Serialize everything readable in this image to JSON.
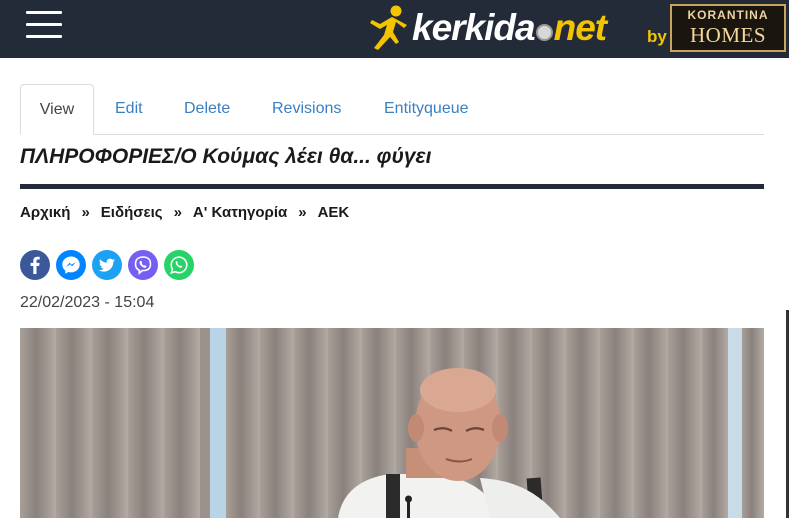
{
  "header": {
    "menu_icon": "hamburger-menu-icon",
    "logo": {
      "part1": "kerkida",
      "part2": "net",
      "by": "by",
      "runner_icon": "footballer-runner-icon",
      "ball_icon": "football-icon"
    },
    "sponsor": {
      "top": "KORANTINA",
      "bottom": "HOMES"
    },
    "colors": {
      "background": "#232b38",
      "accent": "#f5c400"
    }
  },
  "tabs": [
    {
      "label": "View",
      "active": true
    },
    {
      "label": "Edit",
      "active": false
    },
    {
      "label": "Delete",
      "active": false
    },
    {
      "label": "Revisions",
      "active": false
    },
    {
      "label": "Entityqueue",
      "active": false
    }
  ],
  "article": {
    "title": "ΠΛΗΡΟΦΟΡΙΕΣ/Ο Κούμας λέει θα... φύγει",
    "date": "22/02/2023 - 15:04",
    "photo_icon": "article-photo"
  },
  "breadcrumb": {
    "items": [
      "Αρχική",
      "Ειδήσεις",
      "Α' Κατηγορία",
      "ΑΕΚ"
    ],
    "separator": "»"
  },
  "share": [
    {
      "name": "facebook-icon",
      "color": "#3b5998"
    },
    {
      "name": "messenger-icon",
      "color": "#0084ff"
    },
    {
      "name": "twitter-icon",
      "color": "#1da1f2"
    },
    {
      "name": "viber-icon",
      "color": "#7360f2"
    },
    {
      "name": "whatsapp-icon",
      "color": "#25d366"
    }
  ]
}
